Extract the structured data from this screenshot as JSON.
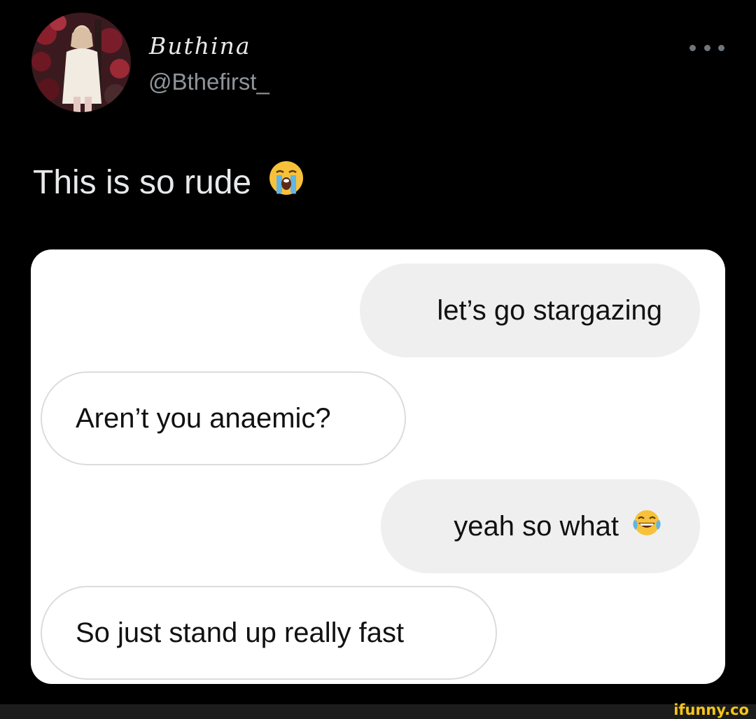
{
  "tweet": {
    "display_name": "Buthina",
    "handle": "@Bthefirst_",
    "text": "This is so rude",
    "text_emoji_icon": "loudly-crying-face-icon",
    "more_icon": "more-options-icon"
  },
  "chat": {
    "messages": [
      {
        "side": "sent",
        "text": "let’s go stargazing"
      },
      {
        "side": "received",
        "text": "Aren’t you anaemic?"
      },
      {
        "side": "sent",
        "text": "yeah so what",
        "emoji_icon": "tears-of-joy-face-icon"
      },
      {
        "side": "received",
        "text": "So just stand up really fast"
      }
    ]
  },
  "watermark": {
    "text": "ifunny.co"
  },
  "colors": {
    "background": "#000000",
    "primary_text": "#e7e9ea",
    "secondary_text": "#8f9499",
    "sent_bubble": "#efefef",
    "received_bubble_border": "#dcdcdc",
    "watermark": "#f5c518"
  }
}
